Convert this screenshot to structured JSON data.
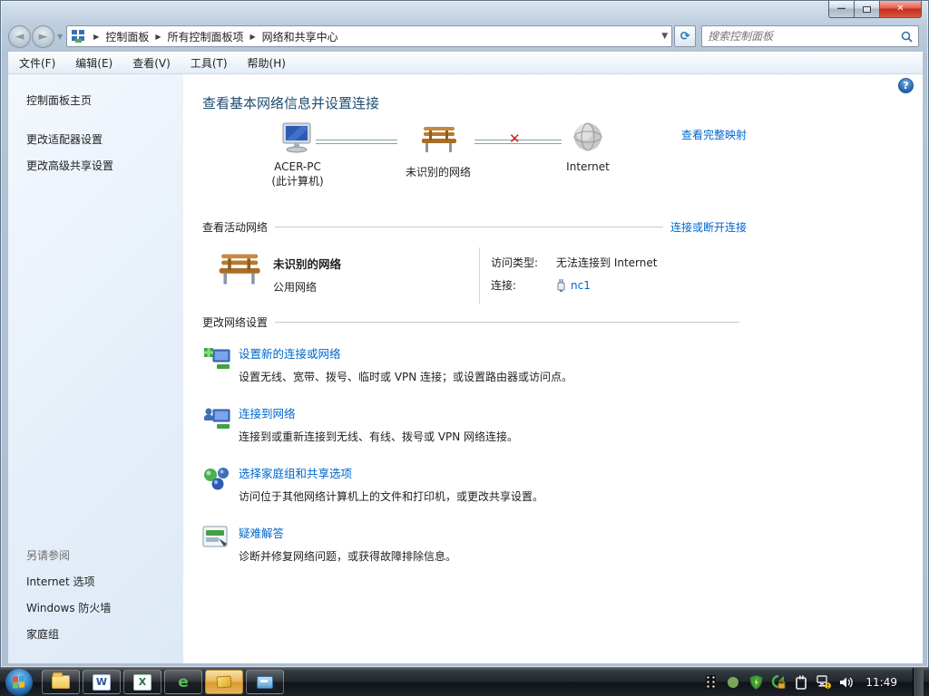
{
  "window": {
    "controls": {
      "minimize": "—",
      "maximize": "",
      "close": "✕"
    }
  },
  "address_bar": {
    "nav": {
      "back": "◄",
      "forward": "►",
      "dropdown": "▼",
      "refresh": "⟳"
    },
    "breadcrumbs": [
      "控制面板",
      "所有控制面板项",
      "网络和共享中心"
    ],
    "separator": "▶",
    "search": {
      "placeholder": "搜索控制面板",
      "icon": "search-icon"
    }
  },
  "menu_bar": {
    "items": [
      "文件(F)",
      "编辑(E)",
      "查看(V)",
      "工具(T)",
      "帮助(H)"
    ]
  },
  "sidebar": {
    "home": "控制面板主页",
    "tasks": [
      "更改适配器设置",
      "更改高级共享设置"
    ],
    "see_also": {
      "header": "另请参阅",
      "items": [
        "Internet 选项",
        "Windows 防火墙",
        "家庭组"
      ]
    }
  },
  "main": {
    "title": "查看基本网络信息并设置连接",
    "help_icon": "?",
    "map": {
      "nodes": [
        {
          "icon": "computer-icon",
          "label": "ACER-PC",
          "sublabel": "(此计算机)"
        },
        {
          "icon": "bench-network-icon",
          "label": "未识别的网络",
          "sublabel": ""
        },
        {
          "icon": "internet-globe-icon",
          "label": "Internet",
          "sublabel": ""
        }
      ],
      "connection_states": [
        "connected",
        "broken"
      ],
      "full_map_link": "查看完整映射"
    },
    "active_networks": {
      "section_title": "查看活动网络",
      "action_link": "连接或断开连接",
      "network_name": "未识别的网络",
      "network_type": "公用网络",
      "access_label": "访问类型:",
      "access_value": "无法连接到 Internet",
      "connection_label": "连接:",
      "connection_value": "nc1",
      "connection_icon": "ethernet-icon"
    },
    "network_settings": {
      "section_title": "更改网络设置",
      "items": [
        {
          "icon": "new-connection-icon",
          "title": "设置新的连接或网络",
          "desc": "设置无线、宽带、拨号、临时或 VPN 连接；或设置路由器或访问点。"
        },
        {
          "icon": "connect-network-icon",
          "title": "连接到网络",
          "desc": "连接到或重新连接到无线、有线、拨号或 VPN 网络连接。"
        },
        {
          "icon": "homegroup-icon",
          "title": "选择家庭组和共享选项",
          "desc": "访问位于其他网络计算机上的文件和打印机，或更改共享设置。"
        },
        {
          "icon": "troubleshoot-icon",
          "title": "疑难解答",
          "desc": "诊断并修复网络问题，或获得故障排除信息。"
        }
      ]
    }
  },
  "taskbar": {
    "start": "start-orb",
    "apps": [
      "explorer",
      "word",
      "excel",
      "internet-explorer",
      "active-window",
      "display-app"
    ],
    "tray_icons": [
      "film-icon",
      "status-dot-icon",
      "security-shield-icon",
      "sync-lock-icon",
      "clipboard-plug-icon",
      "network-warning-icon",
      "speaker-icon"
    ],
    "clock": "11:49"
  },
  "colors": {
    "link_blue": "#0066cc",
    "heading_teal": "#1d4d6e",
    "close_red": "#c22e1c",
    "warning_red": "#cc1f1f",
    "sidebar_blue": "#e6eff9"
  }
}
